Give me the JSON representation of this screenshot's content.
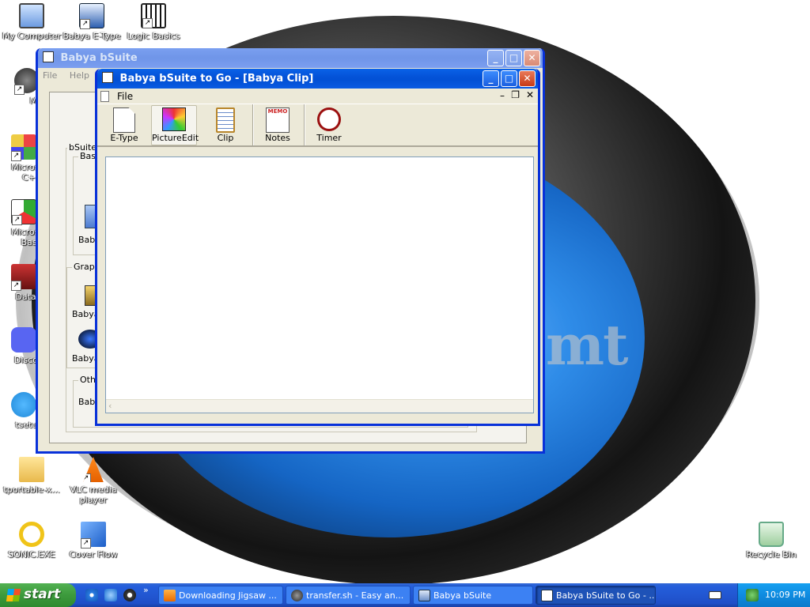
{
  "desktop": {
    "icons": [
      {
        "label": "My Computer"
      },
      {
        "label": "Babya E-Type"
      },
      {
        "label": "Logic Basics"
      },
      {
        "label": "Myp"
      },
      {
        "label": "Microsoft"
      },
      {
        "label": "C++"
      },
      {
        "label": "Microsoft"
      },
      {
        "label": "Basic"
      },
      {
        "label": "DataWa"
      },
      {
        "label": "DiscordS"
      },
      {
        "label": "tsetup-x"
      },
      {
        "label": "tportable-x..."
      },
      {
        "label": "VLC media"
      },
      {
        "label": "player"
      },
      {
        "label": "SONIC.EXE"
      },
      {
        "label": "Cover Flow"
      },
      {
        "label": "Recycle Bin"
      }
    ]
  },
  "back_window": {
    "title": "Babya bSuite",
    "menu": [
      "File",
      "Help"
    ],
    "group_main": "bSuite A",
    "group_basic": "Basic",
    "group_graphics": "Graph",
    "group_other": "Othe",
    "items": [
      "Baby",
      "Babya",
      "Babya",
      "Baby"
    ]
  },
  "front_window": {
    "title": "Babya bSuite to Go - [Babya Clip]",
    "menu_file": "File",
    "toolbar": [
      {
        "label": "E-Type",
        "icon": "document-icon"
      },
      {
        "label": "PictureEdit",
        "icon": "palette-icon"
      },
      {
        "label": "Clip",
        "icon": "clipboard-icon"
      },
      {
        "label": "Notes",
        "icon": "memo-icon",
        "badge": "MEMO"
      },
      {
        "label": "Timer",
        "icon": "clock-icon"
      }
    ]
  },
  "taskbar": {
    "start_label": "start",
    "chevron": "»",
    "tasks": [
      {
        "label": "Downloading Jigsaw ...",
        "active": false
      },
      {
        "label": "transfer.sh - Easy an...",
        "active": false
      },
      {
        "label": "Babya bSuite",
        "active": false
      },
      {
        "label": "Babya bSuite to Go - ...",
        "active": true
      }
    ],
    "clock": "10:09 PM"
  },
  "colors": {
    "title_active": "#0453d8",
    "window_face": "#ece9d8",
    "taskbar": "#245edb",
    "start": "#3c9a3c"
  }
}
